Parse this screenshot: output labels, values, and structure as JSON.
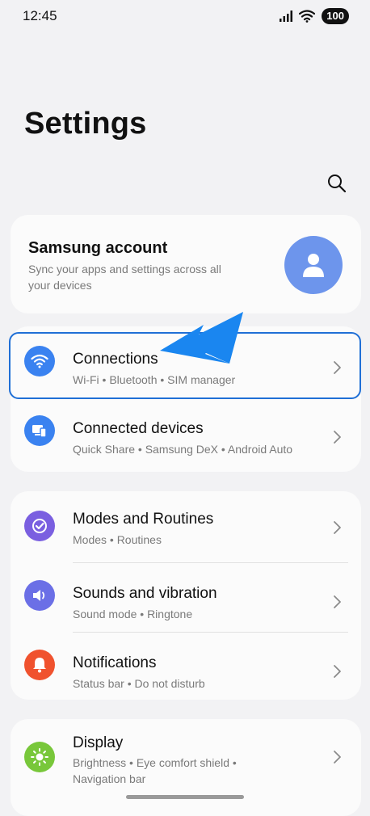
{
  "status_bar": {
    "time": "12:45",
    "battery": "100"
  },
  "page_title": "Settings",
  "account": {
    "title": "Samsung account",
    "subtitle": "Sync your apps and settings across all your devices"
  },
  "items": [
    {
      "title": "Connections",
      "subtitle": "Wi-Fi  •  Bluetooth  •  SIM manager",
      "icon": "wifi-icon",
      "color": "#3a82f0"
    },
    {
      "title": "Connected devices",
      "subtitle": "Quick Share  •  Samsung DeX  •  Android Auto",
      "icon": "connected-devices-icon",
      "color": "#3a82f0"
    },
    {
      "title": "Modes and Routines",
      "subtitle": "Modes  •  Routines",
      "icon": "modes-routines-icon",
      "color": "#7a5fe0"
    },
    {
      "title": "Sounds and vibration",
      "subtitle": "Sound mode  •  Ringtone",
      "icon": "speaker-icon",
      "color": "#6b6fe6"
    },
    {
      "title": "Notifications",
      "subtitle": "Status bar  •  Do not disturb",
      "icon": "bell-icon",
      "color": "#f0522e"
    },
    {
      "title": "Display",
      "subtitle": "Brightness  •  Eye comfort shield  •  Navigation bar",
      "icon": "sun-icon",
      "color": "#78c73a"
    }
  ]
}
